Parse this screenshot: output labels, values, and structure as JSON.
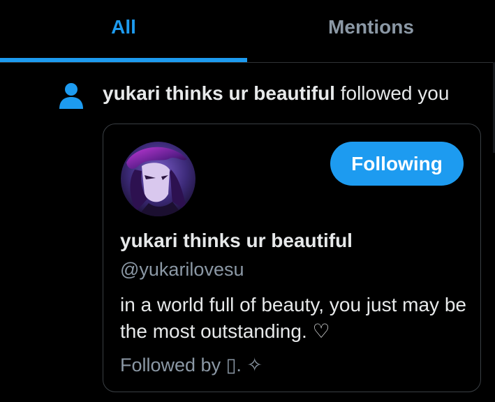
{
  "tabs": [
    {
      "label": "All",
      "active": true
    },
    {
      "label": "Mentions",
      "active": false
    }
  ],
  "notification": {
    "icon": "person-icon",
    "actor_name": "yukari thinks ur beautiful",
    "action_text": "followed you"
  },
  "profile_card": {
    "name": "yukari thinks ur beautiful",
    "handle": "@yukarilovesu",
    "bio": "in a world full of beauty, you just may be the most outstanding. ♡",
    "follow_button_label": "Following",
    "followed_by": "Followed by ▯. ✧"
  },
  "colors": {
    "accent": "#1d9bf0",
    "background": "#000000",
    "muted_text": "#8b98a5",
    "primary_text": "#e7e9ea",
    "card_border": "#3a3f44"
  }
}
